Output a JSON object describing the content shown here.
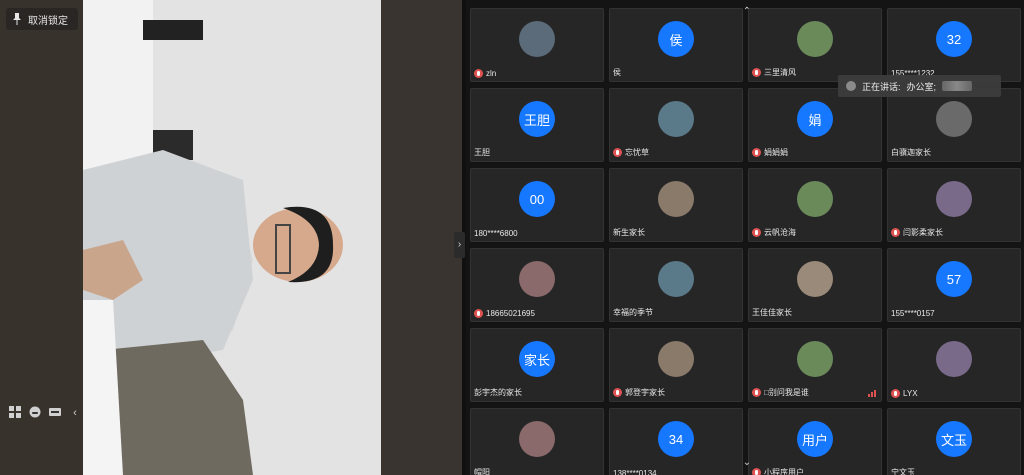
{
  "left": {
    "unlock_label": "取消锁定",
    "tools": [
      "grid-icon",
      "emoji-icon",
      "keyboard-icon",
      "chevron-left-icon"
    ]
  },
  "speaking": {
    "prefix": "正在讲话:",
    "name": "办公室;"
  },
  "gallery": {
    "tiles": [
      {
        "name": "zln",
        "avatar": "",
        "type": "img",
        "mic": true
      },
      {
        "name": "侯",
        "avatar": "侯",
        "type": "text",
        "mic": false
      },
      {
        "name": "三里清风",
        "avatar": "",
        "type": "img",
        "mic": true
      },
      {
        "name": "155****1232",
        "avatar": "32",
        "type": "text",
        "mic": false
      },
      {
        "name": "王胆",
        "avatar": "王胆",
        "type": "text",
        "mic": false
      },
      {
        "name": "忘忧草",
        "avatar": "",
        "type": "img",
        "mic": true
      },
      {
        "name": "娟娟娟",
        "avatar": "娟",
        "type": "text",
        "mic": true
      },
      {
        "name": "白骥迦家长",
        "avatar": "",
        "type": "img",
        "mic": false
      },
      {
        "name": "180****6800",
        "avatar": "00",
        "type": "text",
        "mic": false
      },
      {
        "name": "新生家长",
        "avatar": "",
        "type": "img",
        "mic": false
      },
      {
        "name": "云帆沧海",
        "avatar": "",
        "type": "img",
        "mic": true
      },
      {
        "name": "闫影柔家长",
        "avatar": "",
        "type": "img",
        "mic": true
      },
      {
        "name": "18665021695",
        "avatar": "",
        "type": "img",
        "mic": true
      },
      {
        "name": "幸福的季节",
        "avatar": "",
        "type": "img",
        "mic": false
      },
      {
        "name": "王佳佳家长",
        "avatar": "",
        "type": "img",
        "mic": false
      },
      {
        "name": "155****0157",
        "avatar": "57",
        "type": "text",
        "mic": false
      },
      {
        "name": "彭宇杰的家长",
        "avatar": "家长",
        "type": "text",
        "mic": false
      },
      {
        "name": "郭登宇家长",
        "avatar": "",
        "type": "img",
        "mic": true
      },
      {
        "name": "□别问我是谁",
        "avatar": "",
        "type": "img",
        "mic": true,
        "signal": true
      },
      {
        "name": "LYX",
        "avatar": "",
        "type": "img",
        "mic": true
      },
      {
        "name": "帽阳",
        "avatar": "",
        "type": "img",
        "mic": false
      },
      {
        "name": "138****0134",
        "avatar": "34",
        "type": "text",
        "mic": false
      },
      {
        "name": "小程序用户",
        "avatar": "用户",
        "type": "text",
        "mic": true
      },
      {
        "name": "宁文玉",
        "avatar": "文玉",
        "type": "text",
        "mic": false
      }
    ]
  },
  "colors": {
    "accent": "#1677ff",
    "mic": "#e05252",
    "tile_bg": "#262626"
  }
}
